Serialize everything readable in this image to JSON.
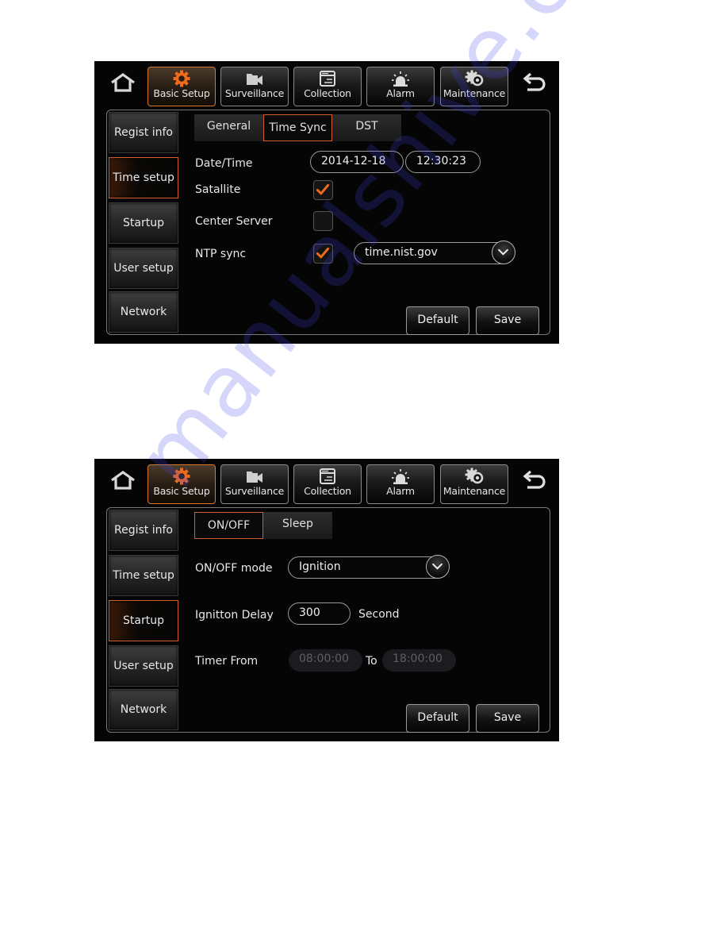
{
  "watermark": "manualshive.com",
  "colors": {
    "accent_orange": "#d0602a",
    "active_tab_border": "#d27a2e",
    "background": "#050505",
    "text": "#e8e8e8",
    "disabled_text": "#5e5e66"
  },
  "nav": {
    "home_icon": "home-icon",
    "back_icon": "back-arrow-icon",
    "tabs": [
      {
        "label": "Basic Setup",
        "icon": "gear-icon",
        "active": true
      },
      {
        "label": "Surveillance",
        "icon": "video-camera-icon",
        "active": false
      },
      {
        "label": "Collection",
        "icon": "window-list-icon",
        "active": false
      },
      {
        "label": "Alarm",
        "icon": "siren-icon",
        "active": false
      },
      {
        "label": "Maintenance",
        "icon": "gears-icon",
        "active": false
      }
    ]
  },
  "sidebar": {
    "items": [
      {
        "label": "Regist info"
      },
      {
        "label": "Time setup"
      },
      {
        "label": "Startup"
      },
      {
        "label": "User setup"
      },
      {
        "label": "Network"
      }
    ]
  },
  "screen1": {
    "active_sidebar": "Time setup",
    "subtabs": [
      {
        "label": "General",
        "active": false
      },
      {
        "label": "Time Sync",
        "active": true
      },
      {
        "label": "DST",
        "active": false
      }
    ],
    "fields": {
      "datetime_label": "Date/Time",
      "date_value": "2014-12-18",
      "time_value": "12:30:23",
      "satellite_label": "Satallite",
      "satellite_checked": true,
      "center_server_label": "Center Server",
      "center_server_checked": false,
      "ntp_label": "NTP sync",
      "ntp_checked": true,
      "ntp_server": "time.nist.gov"
    },
    "buttons": {
      "default": "Default",
      "save": "Save"
    }
  },
  "screen2": {
    "active_sidebar": "Startup",
    "subtabs": [
      {
        "label": "ON/OFF",
        "active": true
      },
      {
        "label": "Sleep",
        "active": false
      }
    ],
    "fields": {
      "mode_label": "ON/OFF mode",
      "mode_value": "Ignition",
      "delay_label": "Ignitton Delay",
      "delay_value": "300",
      "delay_unit": "Second",
      "timer_label": "Timer From",
      "timer_from": "08:00:00",
      "timer_to_label": "To",
      "timer_to": "18:00:00"
    },
    "buttons": {
      "default": "Default",
      "save": "Save"
    }
  }
}
